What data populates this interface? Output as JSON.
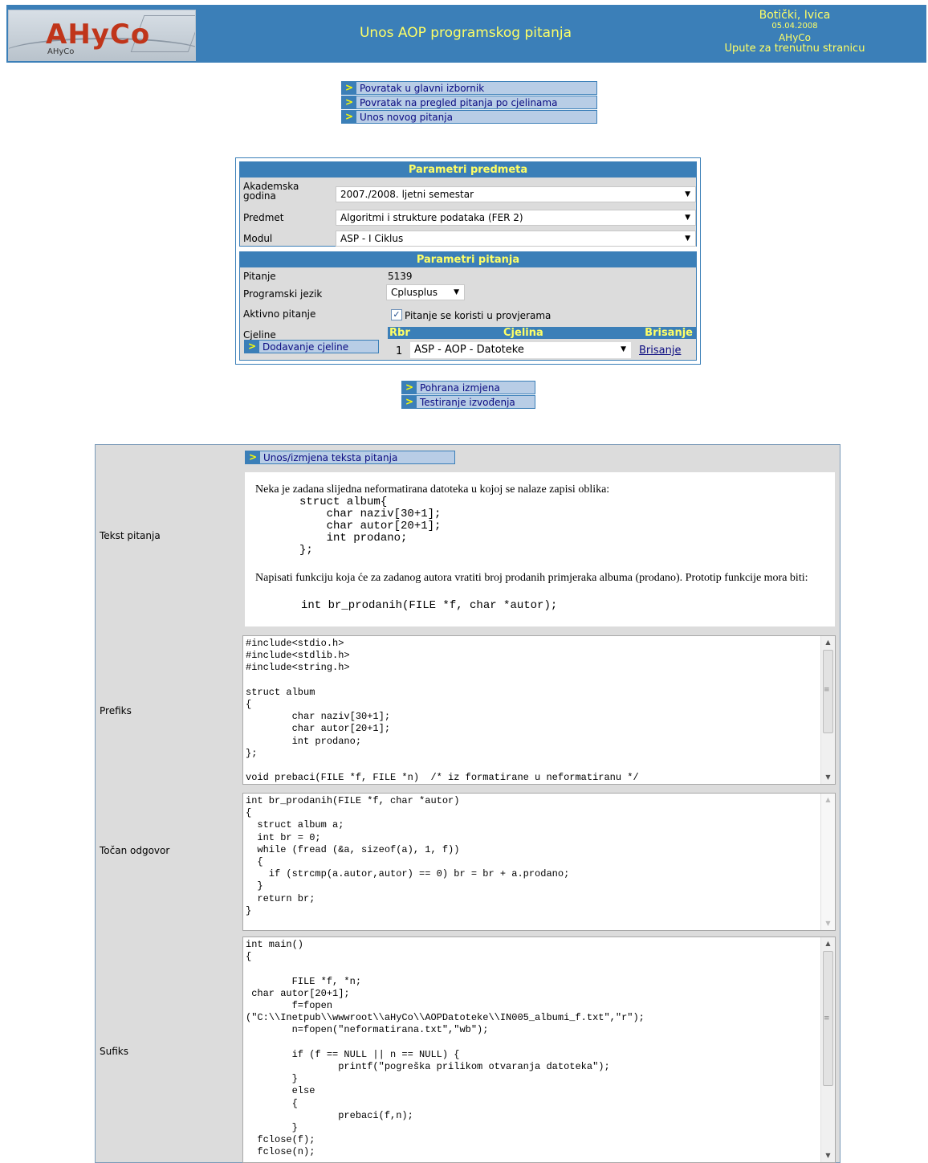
{
  "header": {
    "logo_text": "AHyCo",
    "logo_small": "AHyCo",
    "title": "Unos AOP programskog pitanja",
    "user_name": "Botički, Ivica",
    "date": "05.04.2008",
    "app": "AHyCo",
    "help_link": "Upute za trenutnu stranicu"
  },
  "nav": {
    "main_menu": "Povratak u glavni izbornik",
    "back_overview": "Povratak na pregled pitanja po cjelinama",
    "new_question": "Unos novog pitanja"
  },
  "subject_params": {
    "title": "Parametri predmeta",
    "year_label": "Akademska godina",
    "year_value": "2007./2008. ljetni semestar",
    "subject_label": "Predmet",
    "subject_value": "Algoritmi i strukture podataka (FER 2)",
    "module_label": "Modul",
    "module_value": "ASP - I Ciklus"
  },
  "question_params": {
    "title": "Parametri pitanja",
    "question_label": "Pitanje",
    "question_value": "5139",
    "lang_label": "Programski jezik",
    "lang_value": "Cplusplus",
    "active_label": "Aktivno pitanje",
    "active_checkbox_label": "Pitanje se koristi u provjerama",
    "active_checked": true,
    "units_label": "Cjeline",
    "add_unit_button": "Dodavanje cjeline",
    "units_header": {
      "rbr": "Rbr",
      "unit": "Cjelina",
      "delete": "Brisanje"
    },
    "units_row": {
      "rbr": "1",
      "unit": "ASP - AOP - Datoteke",
      "delete": "Brisanje"
    }
  },
  "actions": {
    "save": "Pohrana izmjena",
    "test": "Testiranje izvođenja"
  },
  "question": {
    "edit_text_button": "Unos/izmjena teksta pitanja",
    "text_label": "Tekst pitanja",
    "text_para1": "Neka je zadana slijedna neformatirana datoteka u kojoj se nalaze zapisi oblika:",
    "text_code1": "struct album{\n    char naziv[30+1];\n    char autor[20+1];\n    int prodano;\n};",
    "text_para2": "Napisati funkciju koja će za zadanog autora vratiti broj prodanih primjeraka albuma (prodano). Prototip funkcije mora biti:",
    "text_code2": "int br_prodanih(FILE *f, char *autor);",
    "prefix_label": "Prefiks",
    "prefix_code": "#include<stdio.h>\n#include<stdlib.h>\n#include<string.h>\n\nstruct album\n{\n        char naziv[30+1];\n        char autor[20+1];\n        int prodano;\n};\n\nvoid prebaci(FILE *f, FILE *n)  /* iz formatirane u neformatiranu */",
    "answer_label": "Točan odgovor",
    "answer_code": "int br_prodanih(FILE *f, char *autor)\n{\n  struct album a;\n  int br = 0;\n  while (fread (&a, sizeof(a), 1, f))\n  {\n    if (strcmp(a.autor,autor) == 0) br = br + a.prodano;\n  }\n  return br;\n}",
    "suffix_label": "Sufiks",
    "suffix_code": "int main()\n{\n\n        FILE *f, *n;\n char autor[20+1];\n        f=fopen\n(\"C:\\\\Inetpub\\\\wwwroot\\\\aHyCo\\\\AOPDatoteke\\\\IN005_albumi_f.txt\",\"r\");\n        n=fopen(\"neformatirana.txt\",\"wb\");\n\n        if (f == NULL || n == NULL) {\n                printf(\"pogreška prilikom otvaranja datoteka\");\n        }\n        else\n        {\n                prebaci(f,n);\n        }\n  fclose(f);\n  fclose(n);"
  },
  "colors": {
    "accent": "#3b7fb8",
    "header_text": "#ffff66",
    "panel_bg": "#dcdcdc",
    "link_button_bg": "#b8cde6"
  }
}
